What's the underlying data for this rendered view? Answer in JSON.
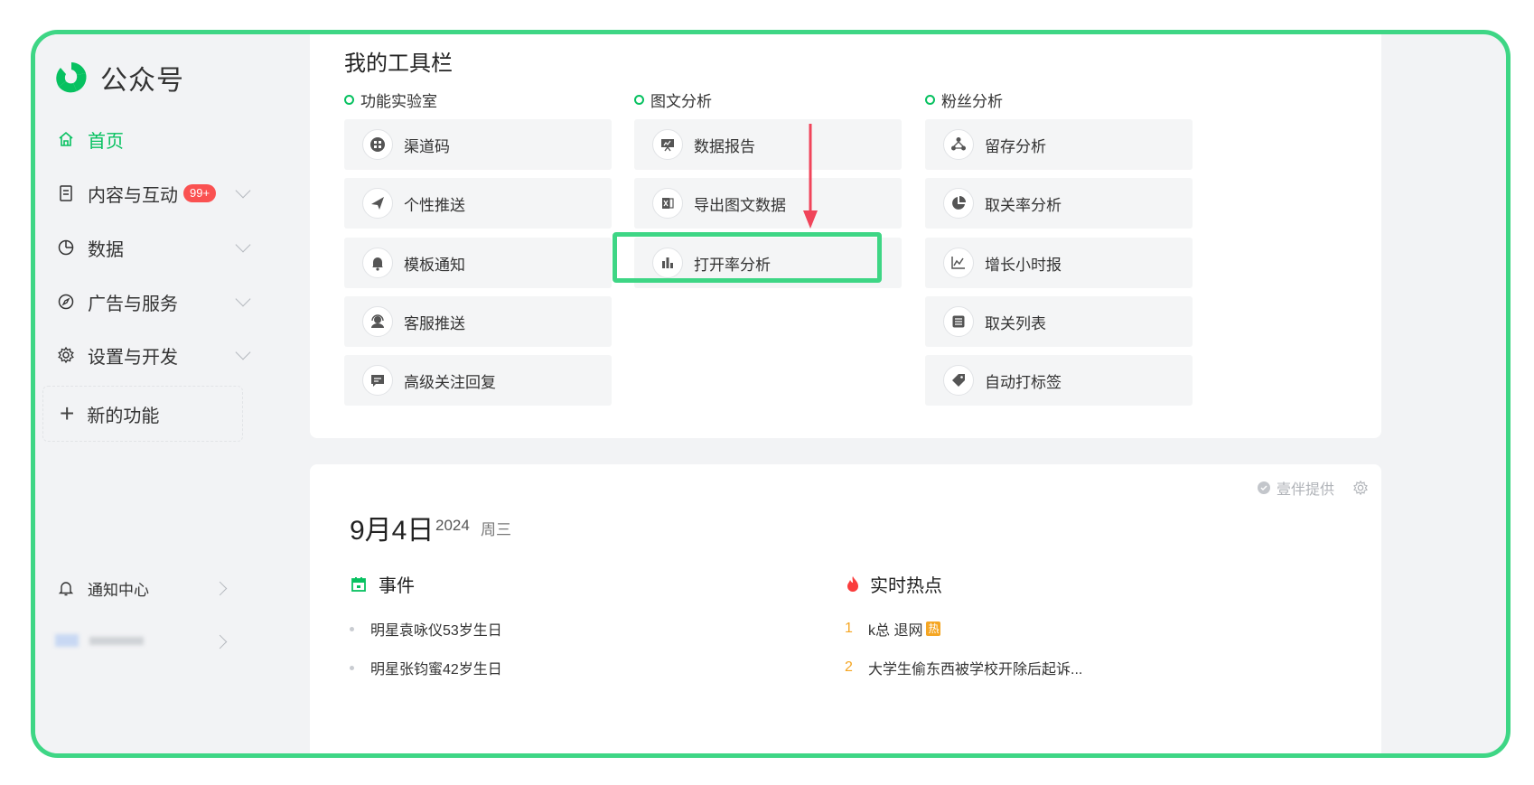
{
  "app": {
    "title": "公众号"
  },
  "sidebar": {
    "items": [
      {
        "label": "首页",
        "icon": "home-icon",
        "active": true
      },
      {
        "label": "内容与互动",
        "icon": "document-icon",
        "badge": "99+"
      },
      {
        "label": "数据",
        "icon": "pie-chart-icon"
      },
      {
        "label": "广告与服务",
        "icon": "compass-icon"
      },
      {
        "label": "设置与开发",
        "icon": "gear-icon"
      }
    ],
    "new_feature": "新的功能",
    "notification_center": "通知中心"
  },
  "toolbar_panel": {
    "title": "我的工具栏",
    "columns": [
      {
        "heading": "功能实验室",
        "tools": [
          {
            "label": "渠道码",
            "icon": "qr-code-icon"
          },
          {
            "label": "个性推送",
            "icon": "paper-plane-icon"
          },
          {
            "label": "模板通知",
            "icon": "bell-icon",
            "highlighted": true
          },
          {
            "label": "客服推送",
            "icon": "customer-service-icon"
          },
          {
            "label": "高级关注回复",
            "icon": "message-icon"
          }
        ]
      },
      {
        "heading": "图文分析",
        "tools": [
          {
            "label": "数据报告",
            "icon": "presentation-icon"
          },
          {
            "label": "导出图文数据",
            "icon": "excel-icon"
          },
          {
            "label": "打开率分析",
            "icon": "bar-chart-icon"
          }
        ]
      },
      {
        "heading": "粉丝分析",
        "tools": [
          {
            "label": "留存分析",
            "icon": "retention-icon"
          },
          {
            "label": "取关率分析",
            "icon": "pie-icon"
          },
          {
            "label": "增长小时报",
            "icon": "line-chart-icon"
          },
          {
            "label": "取关列表",
            "icon": "list-icon"
          },
          {
            "label": "自动打标签",
            "icon": "tag-icon"
          }
        ]
      }
    ]
  },
  "calendar_panel": {
    "date": "9月4日",
    "year": "2024",
    "weekday": "周三",
    "provider": "壹伴提供",
    "events_heading": "事件",
    "events": [
      "明星袁咏仪53岁生日",
      "明星张钧蜜42岁生日"
    ],
    "hot_heading": "实时热点",
    "hot_topics": [
      {
        "rank": "1",
        "text": "k总 退网",
        "tag": "热"
      },
      {
        "rank": "2",
        "text": "大学生偷东西被学校开除后起诉..."
      }
    ]
  },
  "colors": {
    "accent": "#07c160",
    "frame": "#3ed685",
    "badge": "#fa5151",
    "arrow": "#f0445a",
    "hot_rank": "#f5a623"
  }
}
